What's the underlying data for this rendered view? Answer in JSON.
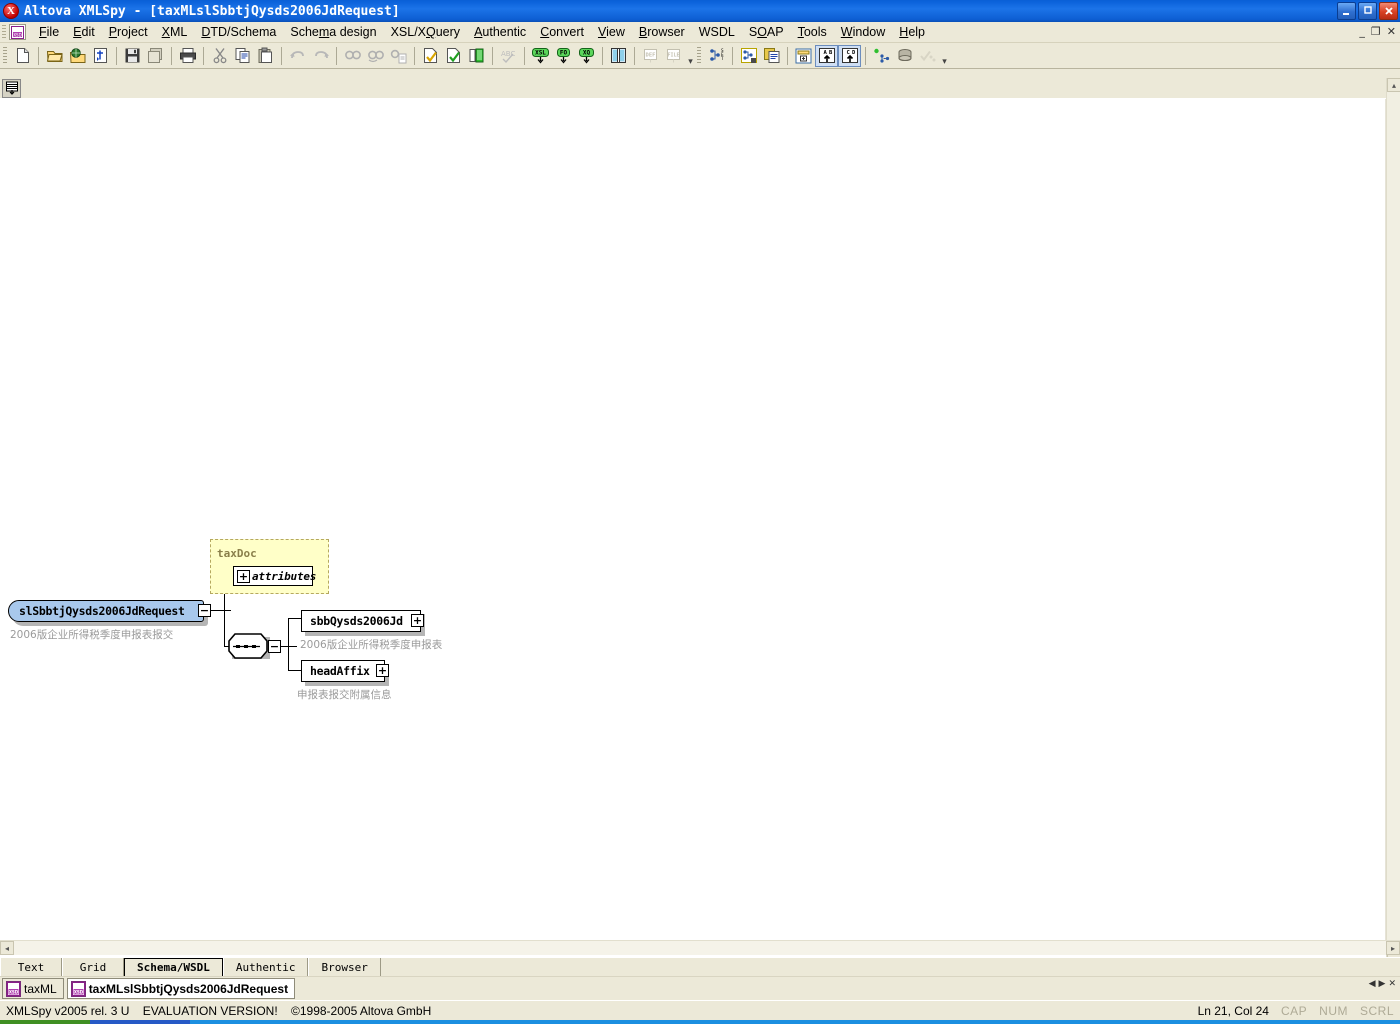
{
  "window": {
    "title": "Altova XMLSpy - [taxMLslSbbtjQysds2006JdRequest]",
    "app_icon": "X",
    "minimize": "minimize-icon",
    "maximize": "restore-icon",
    "close": "close-icon",
    "mdi_minimize": "_",
    "mdi_restore": "❐",
    "mdi_close": "✕"
  },
  "menu": {
    "items": [
      {
        "label": "File",
        "accel": "F"
      },
      {
        "label": "Edit",
        "accel": "E"
      },
      {
        "label": "Project",
        "accel": "P"
      },
      {
        "label": "XML",
        "accel": "X"
      },
      {
        "label": "DTD/Schema",
        "accel": "D"
      },
      {
        "label": "Schema design",
        "accel": "m"
      },
      {
        "label": "XSL/XQuery",
        "accel": "Q"
      },
      {
        "label": "Authentic",
        "accel": "A"
      },
      {
        "label": "Convert",
        "accel": "C"
      },
      {
        "label": "View",
        "accel": "V"
      },
      {
        "label": "Browser",
        "accel": "B"
      },
      {
        "label": "WSDL",
        "accel": ""
      },
      {
        "label": "SOAP",
        "accel": "O"
      },
      {
        "label": "Tools",
        "accel": "T"
      },
      {
        "label": "Window",
        "accel": "W"
      },
      {
        "label": "Help",
        "accel": "H"
      }
    ]
  },
  "toolbar": {
    "groups": [
      [
        "new-file-icon"
      ],
      [
        "open-file-icon",
        "open-url-icon",
        "reload-icon"
      ],
      [
        "save-icon",
        "save-as-icon"
      ],
      [
        "print-icon"
      ],
      [
        "cut-icon",
        "copy-icon",
        "paste-icon"
      ],
      [
        "undo-icon",
        "redo-icon"
      ],
      [
        "find-icon",
        "find-next-icon",
        "find-in-files-icon"
      ],
      [
        "check-wellformed-icon",
        "validate-icon",
        "assign-dtd-icon"
      ],
      [
        "spelling-icon"
      ],
      [
        "xsl-transform-icon",
        "xsl-fo-icon",
        "xquery-icon"
      ],
      [
        "split-view-icon"
      ],
      [
        "assign-def-icon",
        "assign-file-icon"
      ],
      [
        "settings-icon"
      ],
      [
        "schema-design-icon",
        "schema-copy-icon"
      ],
      [
        "append-schema-icon",
        "go-to-def-icon",
        "go-to-child-icon"
      ],
      [
        "soap-debug-icon",
        "soap-request-icon",
        "soap-validate-icon"
      ]
    ]
  },
  "doc_toolbar": {
    "display_all_icon": "display-all-globals-icon"
  },
  "schema": {
    "root_element": {
      "name": "slSbbtjQysds2006JdRequest",
      "description": "2006版企业所得税季度申报表报交",
      "expander": "−"
    },
    "group": {
      "name": "taxDoc",
      "attributes_label": "attributes",
      "attributes_expander": "+"
    },
    "compositor": {
      "type": "sequence",
      "expander": "−"
    },
    "children": [
      {
        "name": "sbbQysds2006Jd",
        "description": "2006版企业所得税季度申报表",
        "expander": "+"
      },
      {
        "name": "headAffix",
        "description": "申报表报交附属信息",
        "expander": "+"
      }
    ]
  },
  "view_tabs": [
    {
      "label": "Text",
      "active": false
    },
    {
      "label": "Grid",
      "active": false
    },
    {
      "label": "Schema/WSDL",
      "active": true
    },
    {
      "label": "Authentic",
      "active": false
    },
    {
      "label": "Browser",
      "active": false
    }
  ],
  "doc_tabs": [
    {
      "label": "taxML",
      "active": false,
      "icon": "xsd-file-icon"
    },
    {
      "label": "taxMLslSbbtjQysds2006JdRequest",
      "active": true,
      "icon": "xsd-file-icon"
    }
  ],
  "doc_tab_nav": {
    "prev": "◀",
    "next": "▶",
    "close": "✕"
  },
  "status": {
    "product": "XMLSpy v2005 rel. 3 U",
    "evaluation": "EVALUATION VERSION!",
    "copyright": "©1998-2005 Altova GmbH",
    "cursor": "Ln 21, Col 24",
    "cap": "CAP",
    "num": "NUM",
    "scrl": "SCRL"
  },
  "scrollbars": {
    "left_arrow": "◀",
    "right_arrow": "▶",
    "up_arrow": "▲",
    "down_arrow": "▼"
  },
  "colors": {
    "titlebar": "#0b62db",
    "chrome": "#ece9d8",
    "group_fill": "#ffffc8",
    "group_border": "#b5a860",
    "element_selected": "#a8c8ec",
    "description_text": "#9a9a9a"
  }
}
